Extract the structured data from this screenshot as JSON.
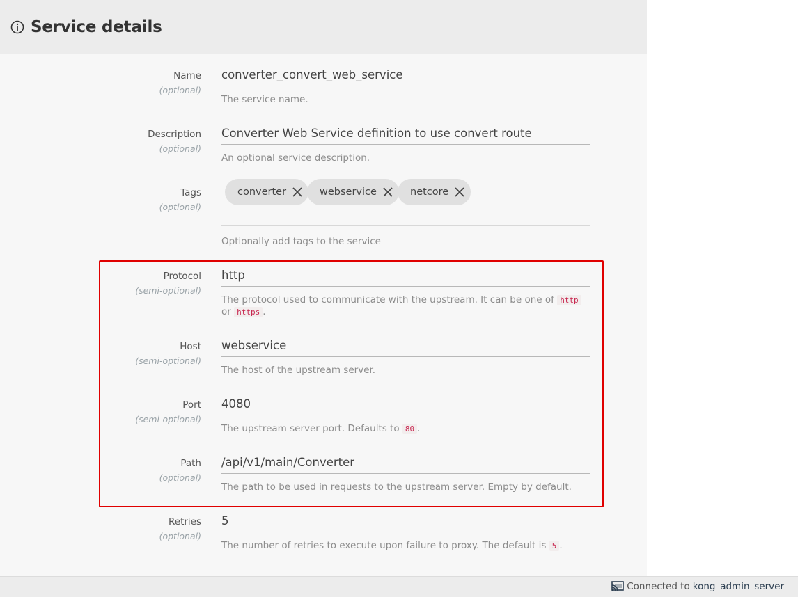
{
  "header": {
    "title": "Service details",
    "icon": "info-icon"
  },
  "fields": {
    "name": {
      "label": "Name",
      "qualifier": "(optional)",
      "value": "converter_convert_web_service",
      "help": "The service name."
    },
    "description": {
      "label": "Description",
      "qualifier": "(optional)",
      "value": "Converter Web Service definition to use convert route",
      "help": "An optional service description."
    },
    "tags": {
      "label": "Tags",
      "qualifier": "(optional)",
      "items": [
        "converter",
        "webservice",
        "netcore"
      ],
      "help": "Optionally add tags to the service"
    },
    "protocol": {
      "label": "Protocol",
      "qualifier": "(semi-optional)",
      "value": "http",
      "help_prefix": "The protocol used to communicate with the upstream. It can be one of",
      "help_code1": "http",
      "help_or": "or",
      "help_code2": "https",
      "help_suffix": "."
    },
    "host": {
      "label": "Host",
      "qualifier": "(semi-optional)",
      "value": "webservice",
      "help": "The host of the upstream server."
    },
    "port": {
      "label": "Port",
      "qualifier": "(semi-optional)",
      "value": "4080",
      "help_prefix": "The upstream server port. Defaults to",
      "help_code": "80",
      "help_suffix": "."
    },
    "path": {
      "label": "Path",
      "qualifier": "(optional)",
      "value": "/api/v1/main/Converter",
      "help": "The path to be used in requests to the upstream server. Empty by default."
    },
    "retries": {
      "label": "Retries",
      "qualifier": "(optional)",
      "value": "5",
      "help_prefix": "The number of retries to execute upon failure to proxy. The default is",
      "help_code": "5",
      "help_suffix": "."
    }
  },
  "status": {
    "prefix": "Connected to",
    "server": "kong_admin_server",
    "icon": "cast-icon"
  },
  "colors": {
    "highlight": "#e00000",
    "code": "#c7254e"
  }
}
